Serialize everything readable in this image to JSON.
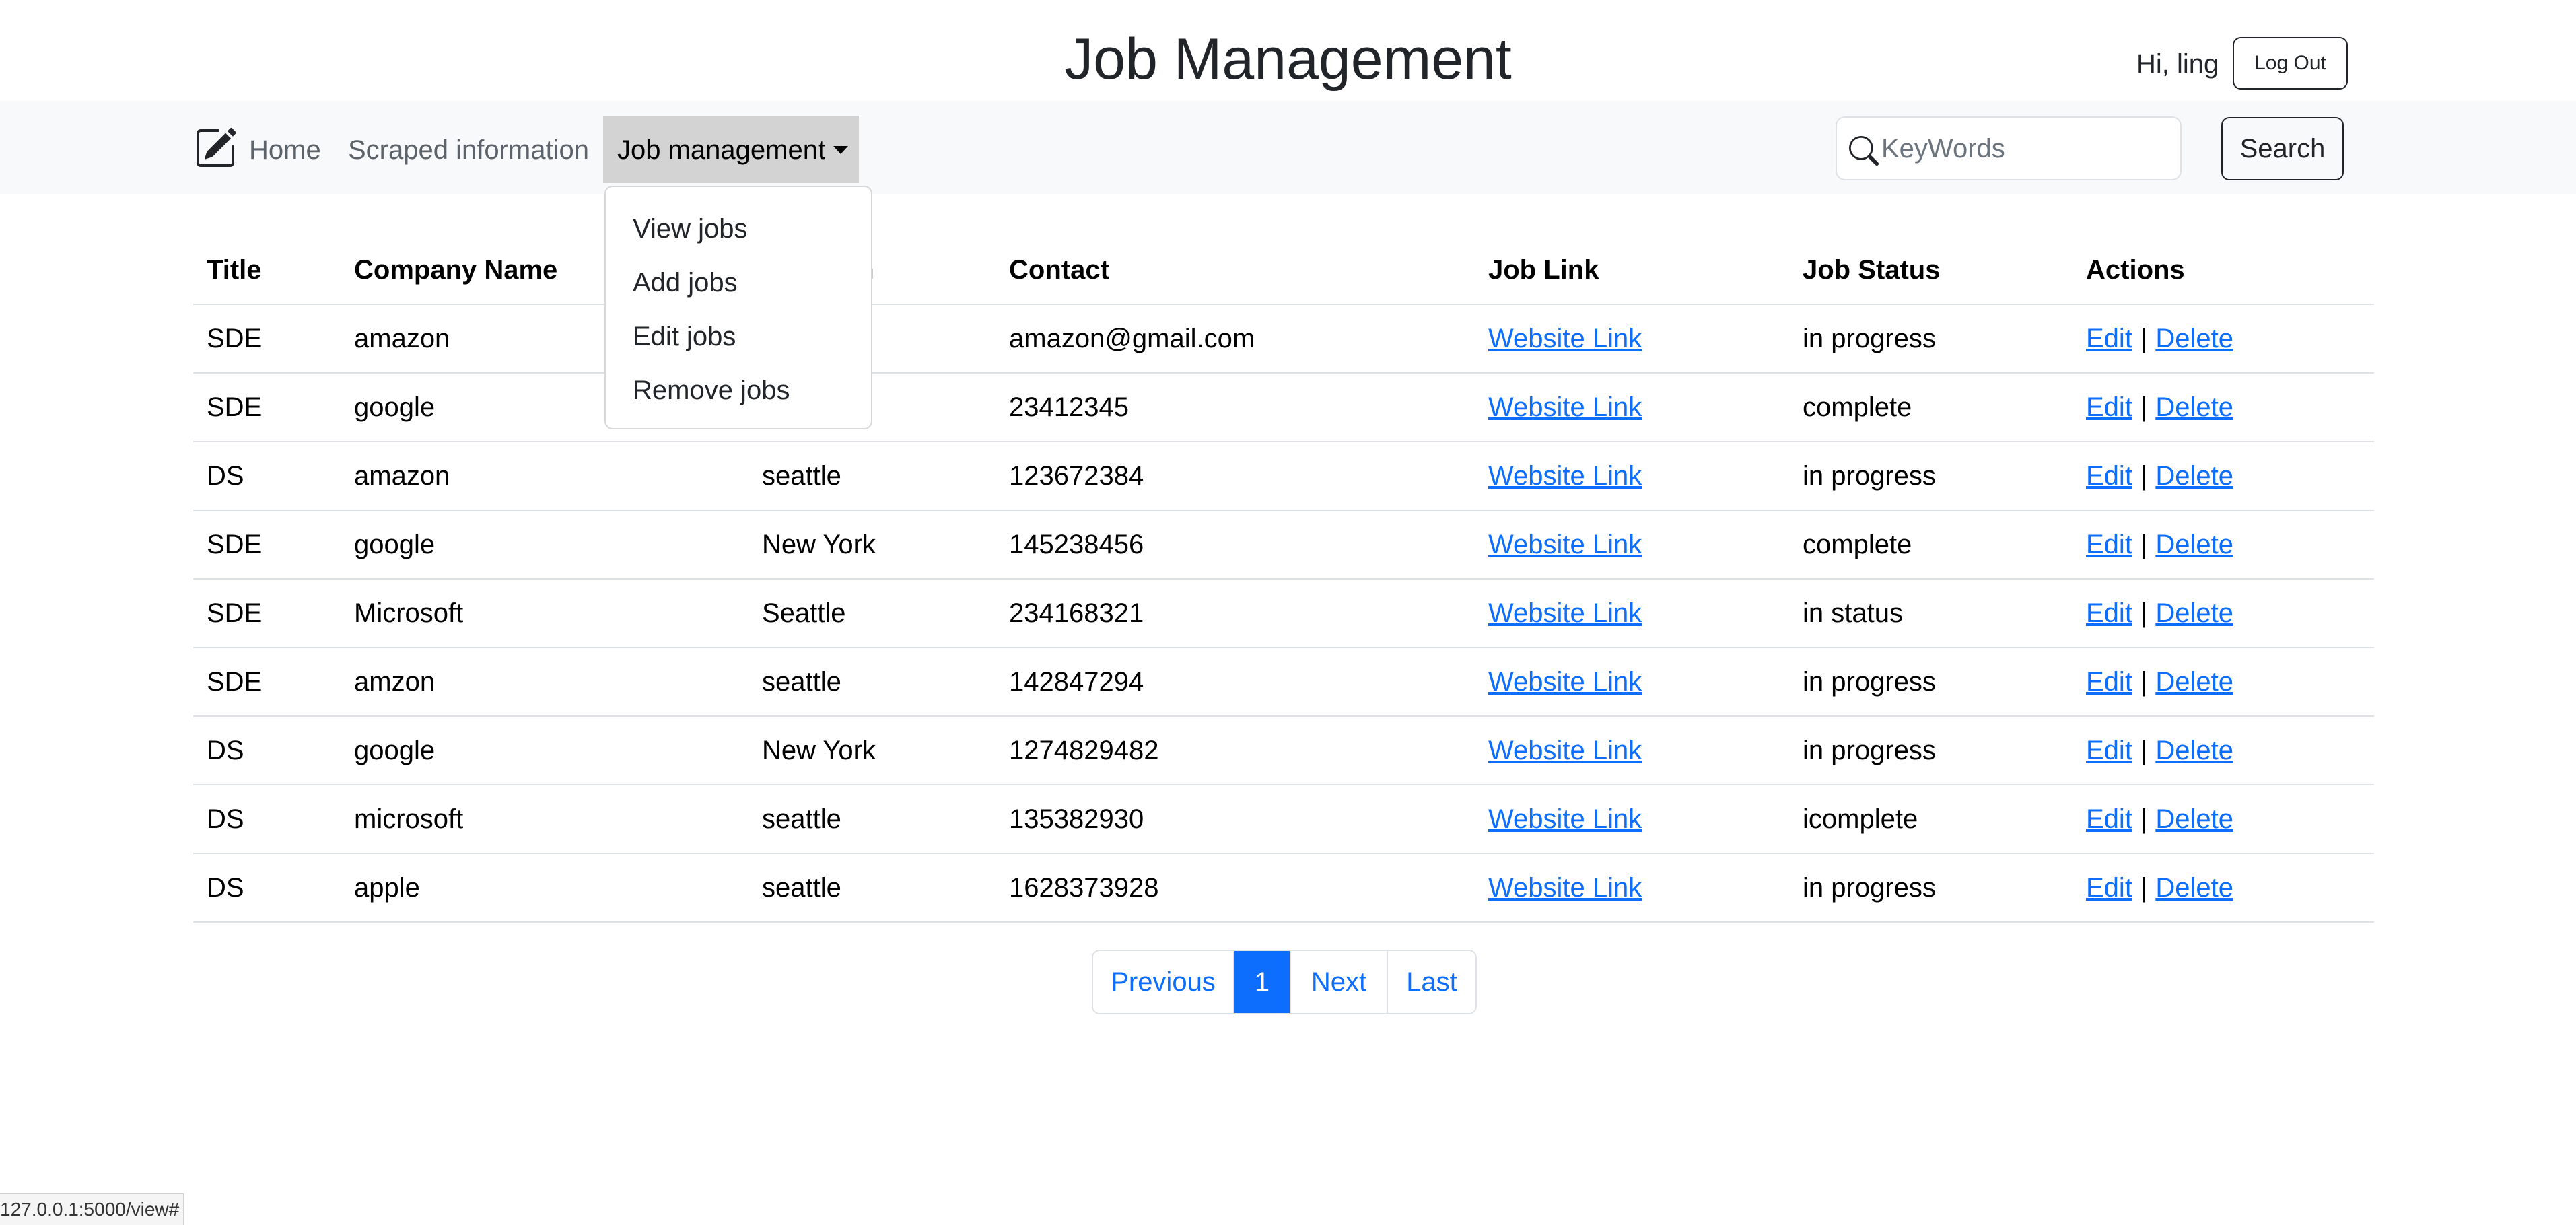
{
  "header": {
    "title": "Job Management",
    "greeting": "Hi, ling",
    "logout_label": "Log Out"
  },
  "navbar": {
    "brand_icon": "edit-square-icon",
    "links": [
      {
        "label": "Home"
      },
      {
        "label": "Scraped information"
      },
      {
        "label": "Job management"
      }
    ],
    "dropdown": {
      "items": [
        {
          "label": "View jobs"
        },
        {
          "label": "Add jobs"
        },
        {
          "label": "Edit jobs"
        },
        {
          "label": "Remove jobs"
        }
      ]
    },
    "search": {
      "icon": "search-icon",
      "placeholder": "KeyWords",
      "value": "",
      "button_label": "Search"
    }
  },
  "table": {
    "columns": [
      "Title",
      "Company Name",
      "Location",
      "Contact",
      "Job Link",
      "Job Status",
      "Actions"
    ],
    "rows": [
      {
        "title": "SDE",
        "company": "amazon",
        "location": "",
        "contact": "amazon@gmail.com",
        "link": "Website Link",
        "status": "in progress",
        "edit": "Edit",
        "sep": "|",
        "delete": "Delete"
      },
      {
        "title": "SDE",
        "company": "google",
        "location": "",
        "contact": "23412345",
        "link": "Website Link",
        "status": "complete",
        "edit": "Edit",
        "sep": "|",
        "delete": "Delete"
      },
      {
        "title": "DS",
        "company": "amazon",
        "location": "seattle",
        "contact": "123672384",
        "link": "Website Link",
        "status": "in progress",
        "edit": "Edit",
        "sep": "|",
        "delete": "Delete"
      },
      {
        "title": "SDE",
        "company": "google",
        "location": "New York",
        "contact": "145238456",
        "link": "Website Link",
        "status": "complete",
        "edit": "Edit",
        "sep": "|",
        "delete": "Delete"
      },
      {
        "title": "SDE",
        "company": "Microsoft",
        "location": "Seattle",
        "contact": "234168321",
        "link": "Website Link",
        "status": "in status",
        "edit": "Edit",
        "sep": "|",
        "delete": "Delete"
      },
      {
        "title": "SDE",
        "company": "amzon",
        "location": "seattle",
        "contact": "142847294",
        "link": "Website Link",
        "status": "in progress",
        "edit": "Edit",
        "sep": "|",
        "delete": "Delete"
      },
      {
        "title": "DS",
        "company": "google",
        "location": "New York",
        "contact": "1274829482",
        "link": "Website Link",
        "status": "in progress",
        "edit": "Edit",
        "sep": "|",
        "delete": "Delete"
      },
      {
        "title": "DS",
        "company": "microsoft",
        "location": "seattle",
        "contact": "135382930",
        "link": "Website Link",
        "status": "icomplete",
        "edit": "Edit",
        "sep": "|",
        "delete": "Delete"
      },
      {
        "title": "DS",
        "company": "apple",
        "location": "seattle",
        "contact": "1628373928",
        "link": "Website Link",
        "status": "in progress",
        "edit": "Edit",
        "sep": "|",
        "delete": "Delete"
      }
    ]
  },
  "pagination": {
    "previous": "Previous",
    "current": "1",
    "next": "Next",
    "last": "Last"
  },
  "status_bar": {
    "url": "127.0.0.1:5000/view#"
  },
  "colors": {
    "accent": "#0d6efd",
    "navbar_bg": "#f8f9fa",
    "active_nav_bg": "#d3d3d3"
  }
}
